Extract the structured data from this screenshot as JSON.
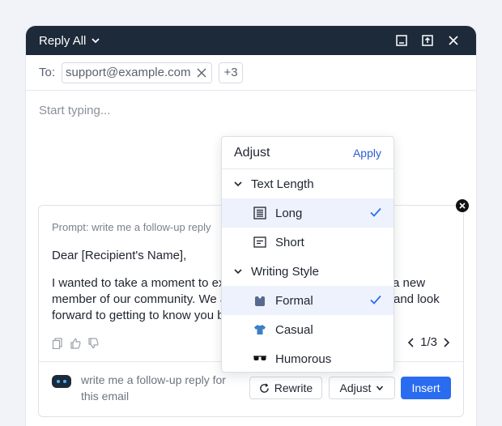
{
  "window": {
    "title": "Reply All"
  },
  "to": {
    "label": "To:",
    "recipient": "support@example.com",
    "more": "+3"
  },
  "compose": {
    "placeholder": "Start typing..."
  },
  "assistant": {
    "prompt_line": "Prompt: write me a follow-up reply",
    "greeting": "Dear [Recipient's Name],",
    "para1_left": "I wanted to take a moment to ex",
    "para1_right": "a new",
    "para2_left": "member of our community. We a",
    "para2_right": "and look",
    "para3_left": "forward to getting to know you b",
    "pager": "1/3",
    "prompt_input": "write me a follow-up reply for this email",
    "rewrite_label": "Rewrite",
    "adjust_label": "Adjust",
    "insert_label": "Insert"
  },
  "dropdown": {
    "title": "Adjust",
    "apply": "Apply",
    "sections": [
      {
        "label": "Text Length",
        "items": [
          {
            "label": "Long",
            "icon": "long-text-icon",
            "selected": true
          },
          {
            "label": "Short",
            "icon": "short-text-icon",
            "selected": false
          }
        ]
      },
      {
        "label": "Writing Style",
        "items": [
          {
            "label": "Formal",
            "icon": "suit-icon",
            "selected": true
          },
          {
            "label": "Casual",
            "icon": "tshirt-icon",
            "selected": false
          },
          {
            "label": "Humorous",
            "icon": "sunglasses-icon",
            "selected": false
          }
        ]
      }
    ]
  },
  "colors": {
    "titlebar": "#1d2a3a",
    "accent": "#2a6cf0",
    "selected_bg": "#edf2fc"
  }
}
